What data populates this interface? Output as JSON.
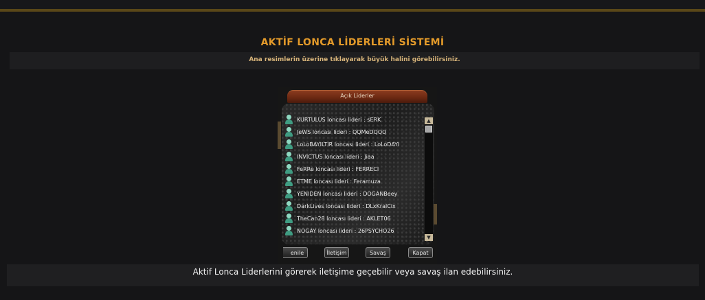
{
  "page": {
    "title": "AKTİF LONCA LİDERLERİ SİSTEMİ",
    "subtitle": "Ana resimlerin üzerine tıklayarak büyük halini görebilirsiniz.",
    "caption": "Aktif Lonca Liderlerini görerek iletişime geçebilir veya savaş ilan edebilirsiniz."
  },
  "game_window": {
    "header": "Açık Liderler",
    "items": [
      {
        "label": "KURTULUS loncası lideri : sERK"
      },
      {
        "label": "JeWS loncası lideri : QQMeDQQQ"
      },
      {
        "label": "LoLoBAYILTIR loncası lideri : LoLoDAYI"
      },
      {
        "label": "INVICTUS loncası lideri : Jiaa"
      },
      {
        "label": "FeRRe loncası lideri : FERRECI"
      },
      {
        "label": "ETME loncası lideri : Feramuza"
      },
      {
        "label": "YENIDEN loncası lideri : DOGANBeey"
      },
      {
        "label": "DarkLives loncası lideri : DLxKralCix"
      },
      {
        "label": "TheCan28 loncası lideri : AKLET06"
      },
      {
        "label": "NOGAY loncası lideri : 26PSYCHO26"
      }
    ],
    "buttons": {
      "refresh": "enile",
      "contact": "İletişim",
      "war": "Savaş",
      "close": "Kapat"
    }
  },
  "colors": {
    "accent": "#e39a2a",
    "top_bar": "#5a4718",
    "background": "#151517"
  }
}
